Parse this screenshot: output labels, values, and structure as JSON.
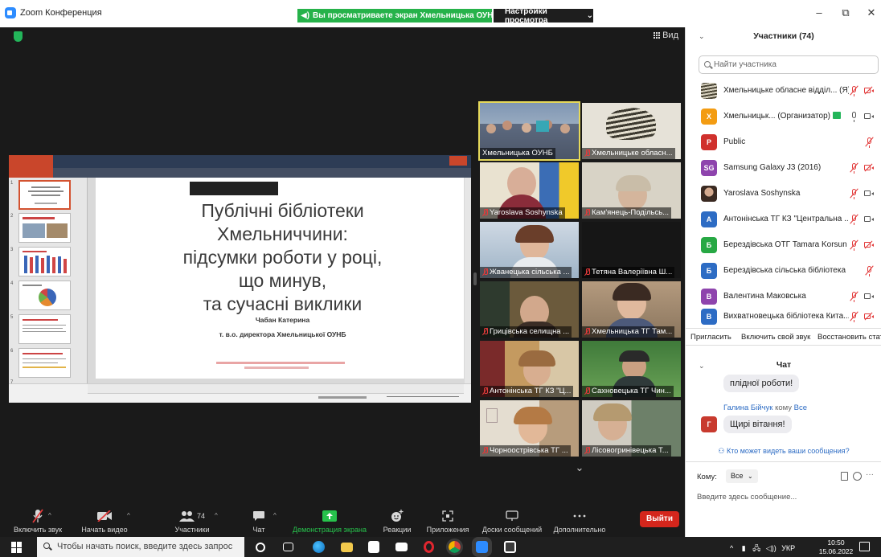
{
  "window": {
    "app_title": "Zoom Конференция",
    "share_banner": "Вы просматриваете экран Хмельницька ОУНБ",
    "view_options": "Настройки просмотра",
    "minimize": "–",
    "restore": "⧉",
    "close": "✕"
  },
  "main": {
    "view_label": "Вид",
    "presentation": {
      "title": "Публічні бібліотеки\nХмельниччини:\nпідсумки роботи у році,\nщо минув,\nта  сучасні виклики",
      "author": "Чабан Катерина",
      "position": "т. в.о. директора Хмельницької ОУНБ",
      "thumb_numbers": [
        "1",
        "2",
        "3",
        "4",
        "5",
        "6",
        "7"
      ]
    },
    "tiles": [
      {
        "label": "Хмельницька ОУНБ",
        "muted": false,
        "active": true
      },
      {
        "label": "Хмельницьке обласн...",
        "muted": true,
        "active": false
      },
      {
        "label": "Yaroslava Soshynska",
        "muted": true,
        "active": false
      },
      {
        "label": "Кам'янець-Подільсь...",
        "muted": true,
        "active": false
      },
      {
        "label": "Жванецька сільська ...",
        "muted": true,
        "active": false
      },
      {
        "label": "Тетяна Валеріївна Ш...",
        "muted": true,
        "active": false
      },
      {
        "label": "Грицівська селищна ...",
        "muted": true,
        "active": false
      },
      {
        "label": "Хмельницька ТГ Там...",
        "muted": true,
        "active": false
      },
      {
        "label": "Антонінська ТГ КЗ \"Ц...",
        "muted": true,
        "active": false
      },
      {
        "label": "Сахновецька ТГ Чин...",
        "muted": true,
        "active": false
      },
      {
        "label": "Чорноострівська ТГ ...",
        "muted": true,
        "active": false
      },
      {
        "label": "Лісовогринівецька Т...",
        "muted": true,
        "active": false
      }
    ],
    "scroll_down": "⌄"
  },
  "toolbar": {
    "unmute": "Включить звук",
    "start_video": "Начать видео",
    "participants": "Участники",
    "participants_count": "74",
    "chat": "Чат",
    "share_screen": "Демонстрация экрана",
    "reactions": "Реакции",
    "apps": "Приложения",
    "whiteboards": "Доски сообщений",
    "more": "Дополнительно",
    "leave": "Выйти"
  },
  "panel": {
    "participants_title": "Участники (74)",
    "search_placeholder": "Найти участника",
    "participants": [
      {
        "name": "Хмельницьке обласне відділ... (Я)",
        "avatar": "",
        "color": "#8a8060",
        "mic": "off",
        "cam": "off"
      },
      {
        "name": "Хмельницьк... (Организатор)",
        "avatar": "Х",
        "color": "#f39c12",
        "mic": "on",
        "cam": "on",
        "host": true
      },
      {
        "name": "Public",
        "avatar": "P",
        "color": "#d0312d",
        "mic": "off",
        "cam": "none"
      },
      {
        "name": "Samsung Galaxy J3 (2016)",
        "avatar": "SG",
        "color": "#8e44ad",
        "mic": "off",
        "cam": "off"
      },
      {
        "name": "Yaroslava Soshynska",
        "avatar": "",
        "color": "#9b7a66",
        "mic": "off",
        "cam": "on"
      },
      {
        "name": "Антонінська ТГ КЗ \"Центральна ...",
        "avatar": "А",
        "color": "#2d6cc4",
        "mic": "off",
        "cam": "off"
      },
      {
        "name": "Берездівська ОТГ Tamara Korsun",
        "avatar": "Б",
        "color": "#27a844",
        "mic": "off",
        "cam": "off"
      },
      {
        "name": "Берездівська сільська бібліотека",
        "avatar": "Б",
        "color": "#2d6cc4",
        "mic": "off",
        "cam": "none"
      },
      {
        "name": "Валентина Маковська",
        "avatar": "В",
        "color": "#8e44ad",
        "mic": "off",
        "cam": "on"
      },
      {
        "name": "Вихватновецька бібліотека Кита...",
        "avatar": "В",
        "color": "#2d6cc4",
        "mic": "off",
        "cam": "off"
      }
    ],
    "actions": {
      "invite": "Пригласить",
      "unmute_me": "Включить свой звук",
      "restore": "Восстановить статус"
    },
    "chat": {
      "title": "Чат",
      "prev_message": "плідної роботи!",
      "sender": "Галина Бійчук",
      "to_word": "кому",
      "recipient": "Все",
      "avatar": "Г",
      "message": "Щирі вітання!",
      "who_can_see": "Кто может видеть ваши сообщения?",
      "to_label": "Кому:",
      "to_value": "Все",
      "input_placeholder": "Введите здесь сообщение..."
    }
  },
  "taskbar": {
    "search_placeholder": "Чтобы начать поиск, введите здесь запрос",
    "language": "УКР",
    "time": "10:50",
    "date": "15.06.2022"
  }
}
